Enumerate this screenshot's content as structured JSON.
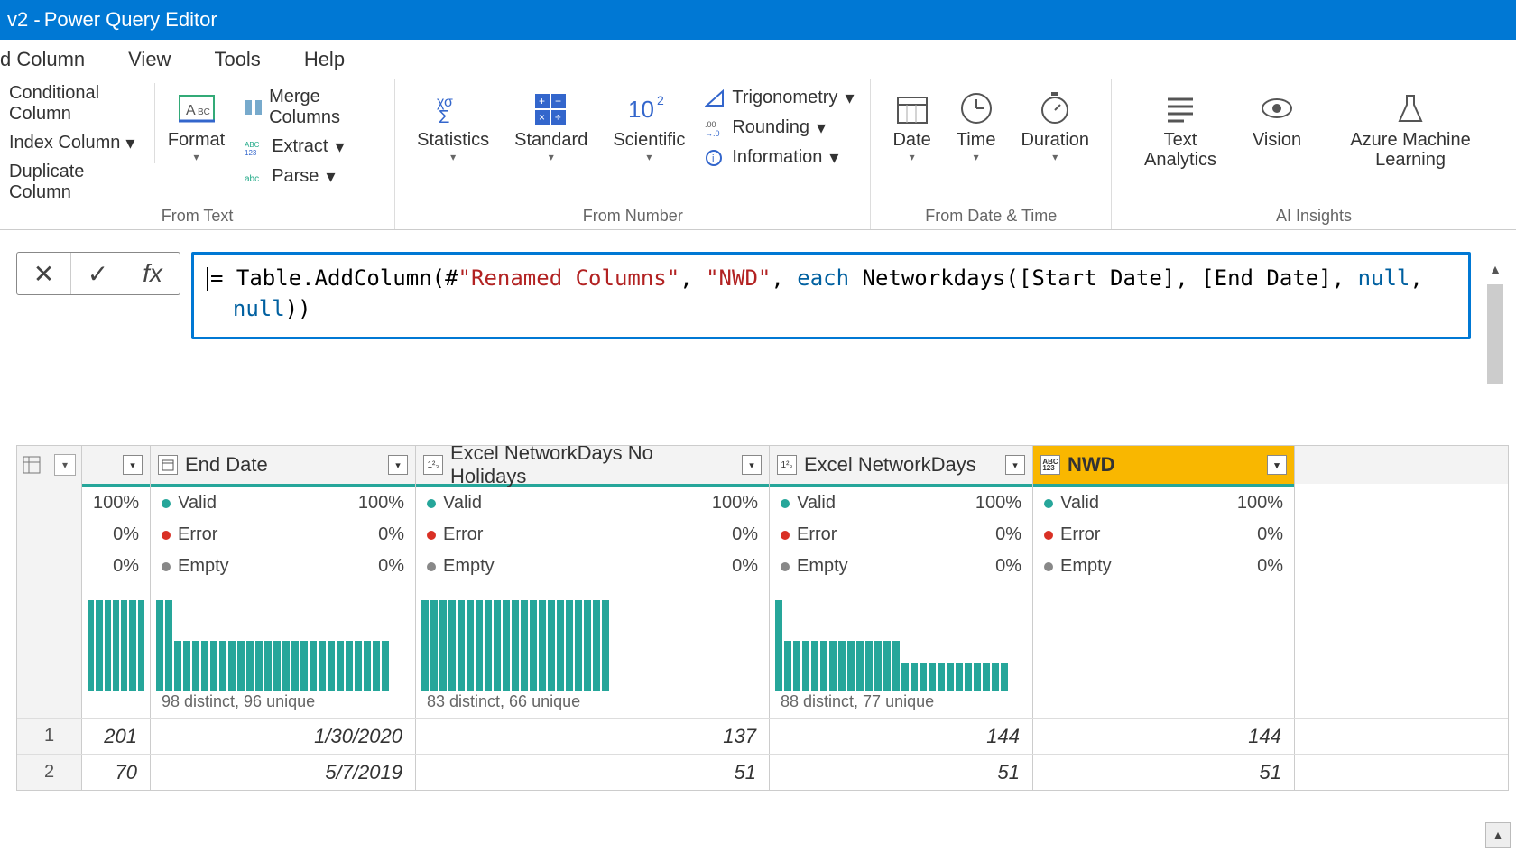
{
  "title": {
    "prefix": "v2 -",
    "text": "Power Query Editor"
  },
  "menu": {
    "addColumn": "d Column",
    "view": "View",
    "tools": "Tools",
    "help": "Help"
  },
  "ribbon": {
    "conditional": "Conditional Column",
    "index": "Index Column",
    "duplicate": "Duplicate Column",
    "format": "Format",
    "merge": "Merge Columns",
    "extract": "Extract",
    "parse": "Parse",
    "fromText": "From Text",
    "statistics": "Statistics",
    "standard": "Standard",
    "scientific": "Scientific",
    "trig": "Trigonometry",
    "rounding": "Rounding",
    "information": "Information",
    "fromNumber": "From Number",
    "date": "Date",
    "time": "Time",
    "duration": "Duration",
    "fromDateTime": "From Date & Time",
    "textAnalytics": "Text Analytics",
    "vision": "Vision",
    "azureML": "Azure Machine Learning",
    "aiInsights": "AI Insights"
  },
  "formula": {
    "part1": "= Table.AddColumn(#",
    "q1": "\"Renamed Columns\"",
    "part2": ", ",
    "q2": "\"NWD\"",
    "part3": ", ",
    "kw_each": "each",
    "part4": " Networkdays([Start Date], [End Date], ",
    "kw_null1": "null",
    "part5": ", ",
    "indent_pad": "",
    "kw_null2": "null",
    "part6": "))"
  },
  "columns": {
    "idx_label": "",
    "end": "End Date",
    "nwd1": "Excel NetworkDays No Holidays",
    "nwd2": "Excel NetworkDays",
    "nwd3": "NWD"
  },
  "quality": {
    "valid": "Valid",
    "error": "Error",
    "empty": "Empty",
    "p100": "100%",
    "p0": "0%"
  },
  "distinct": {
    "idx": "",
    "end": "98 distinct, 96 unique",
    "nwd1": "83 distinct, 66 unique",
    "nwd2": "88 distinct, 77 unique",
    "nwd3": ""
  },
  "rows": [
    {
      "n": "1",
      "idx": "201",
      "end": "1/30/2020",
      "a": "137",
      "b": "144",
      "c": "144"
    },
    {
      "n": "2",
      "idx": "70",
      "end": "5/7/2019",
      "a": "51",
      "b": "51",
      "c": "51"
    }
  ],
  "chart_data": [
    {
      "name": "idx",
      "type": "bar",
      "values": [
        100,
        100,
        100,
        100,
        100,
        100,
        100
      ]
    },
    {
      "name": "end",
      "type": "bar",
      "values": [
        100,
        100,
        55,
        55,
        55,
        55,
        55,
        55,
        55,
        55,
        55,
        55,
        55,
        55,
        55,
        55,
        55,
        55,
        55,
        55,
        55,
        55,
        55,
        55,
        55,
        55
      ]
    },
    {
      "name": "nwd1",
      "type": "bar",
      "values": [
        100,
        100,
        100,
        100,
        100,
        100,
        100,
        100,
        100,
        100,
        100,
        100,
        100,
        100,
        100,
        100,
        100,
        100,
        100,
        100,
        100
      ]
    },
    {
      "name": "nwd2",
      "type": "bar",
      "values": [
        100,
        55,
        55,
        55,
        55,
        55,
        55,
        55,
        55,
        55,
        55,
        55,
        55,
        55,
        30,
        30,
        30,
        30,
        30,
        30,
        30,
        30,
        30,
        30,
        30,
        30
      ]
    },
    {
      "name": "nwd3",
      "type": "bar",
      "values": []
    }
  ]
}
